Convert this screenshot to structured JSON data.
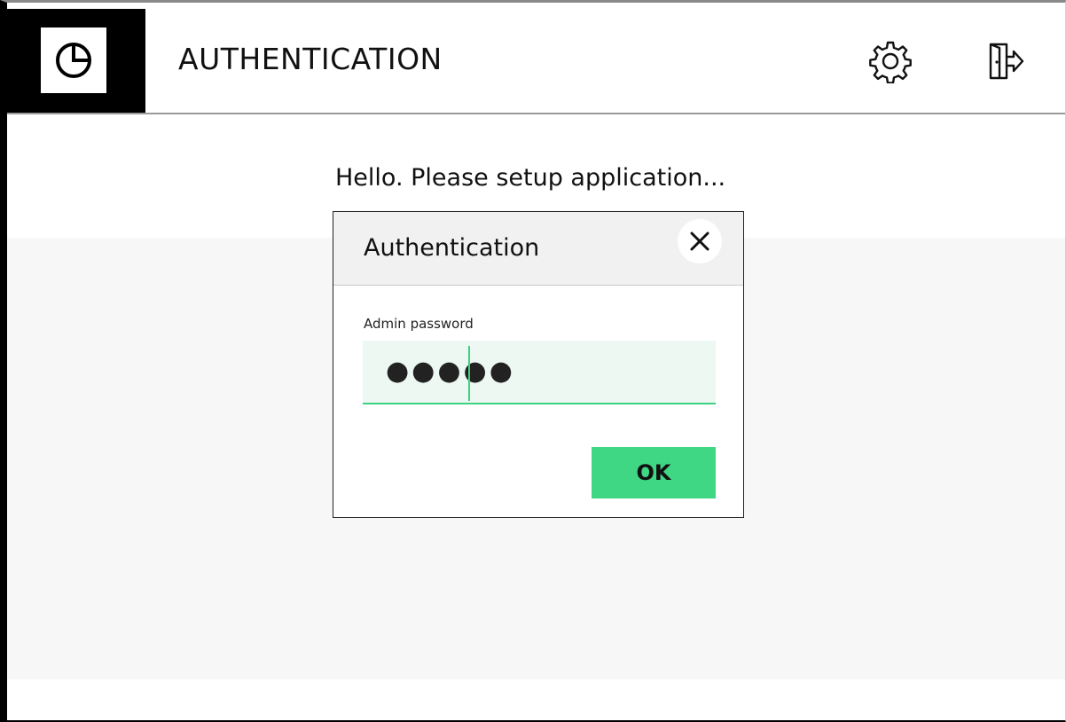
{
  "header": {
    "title": "AUTHENTICATION",
    "logo_icon": "pie-chart-icon",
    "settings_icon": "gear-icon",
    "logout_icon": "exit-door-icon"
  },
  "main": {
    "greeting": "Hello. Please setup application..."
  },
  "dialog": {
    "title": "Authentication",
    "close_icon": "close-icon",
    "password_label": "Admin password",
    "password_value": "●●●●●",
    "ok_label": "OK"
  },
  "colors": {
    "accent": "#3fd684",
    "field_bg": "#eef8f2",
    "logo_bg": "#000000"
  }
}
